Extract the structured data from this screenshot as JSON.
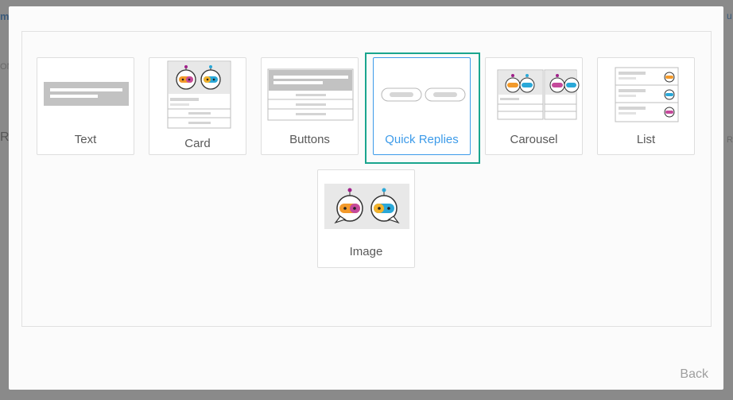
{
  "dialog": {
    "tiles": [
      {
        "id": "text",
        "label": "Text",
        "icon": "text-template-icon"
      },
      {
        "id": "card",
        "label": "Card",
        "icon": "card-template-icon"
      },
      {
        "id": "buttons",
        "label": "Buttons",
        "icon": "buttons-template-icon"
      },
      {
        "id": "quick-replies",
        "label": "Quick Replies",
        "icon": "quick-replies-template-icon",
        "selected": true
      },
      {
        "id": "carousel",
        "label": "Carousel",
        "icon": "carousel-template-icon"
      },
      {
        "id": "list",
        "label": "List",
        "icon": "list-template-icon"
      },
      {
        "id": "image",
        "label": "Image",
        "icon": "image-template-icon"
      }
    ],
    "back_label": "Back"
  },
  "colors": {
    "selected_border": "#1aa58e",
    "selected_text": "#3d9be9",
    "overlay": "#7f7f7f"
  }
}
